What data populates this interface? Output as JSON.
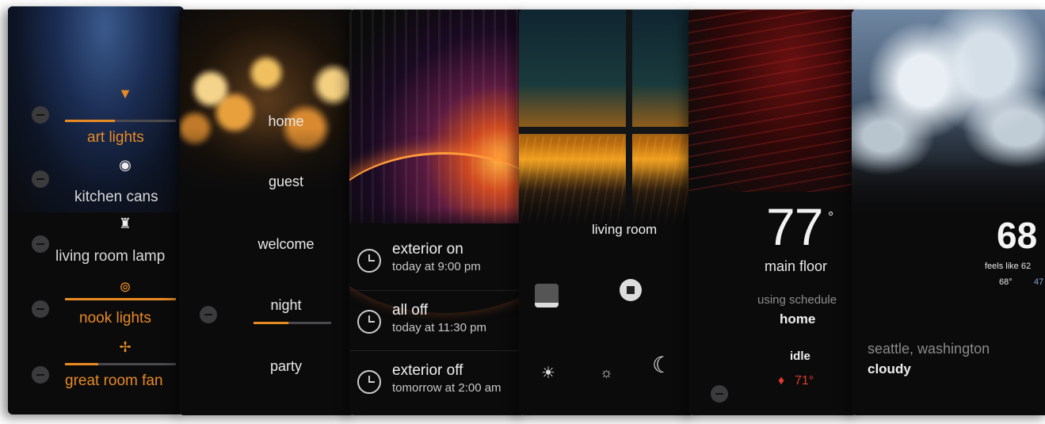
{
  "lights": {
    "items": [
      {
        "label": "art lights",
        "level": 0.45,
        "active": true
      },
      {
        "label": "kitchen cans",
        "level": 0,
        "active": false
      },
      {
        "label": "living room lamp",
        "level": 0,
        "active": false
      },
      {
        "label": "nook lights",
        "level": 1.0,
        "active": true
      },
      {
        "label": "great room fan",
        "level": 0.3,
        "active": true
      }
    ]
  },
  "scenes": {
    "items": [
      "home",
      "guest",
      "welcome",
      "night",
      "party"
    ],
    "selected": "night"
  },
  "schedule": {
    "events": [
      {
        "title": "exterior on",
        "time": "today at 9:00 pm"
      },
      {
        "title": "all off",
        "time": "today at 11:30 pm"
      },
      {
        "title": "exterior off",
        "time": "tomorrow at 2:00 am"
      }
    ]
  },
  "shades": {
    "room": "living room"
  },
  "thermostat": {
    "temp": "77",
    "degree": "°",
    "zone": "main floor",
    "schedule_label": "using schedule",
    "schedule_name": "home",
    "status": "idle",
    "setpoint": "71°"
  },
  "weather": {
    "temp": "68",
    "feels_like": "feels like 62",
    "high": "68°",
    "low": "47",
    "location": "seattle, washington",
    "condition": "cloudy"
  },
  "colors": {
    "accent": "#e88a22",
    "flame": "#e03a2a",
    "low": "#7fa7d8"
  }
}
